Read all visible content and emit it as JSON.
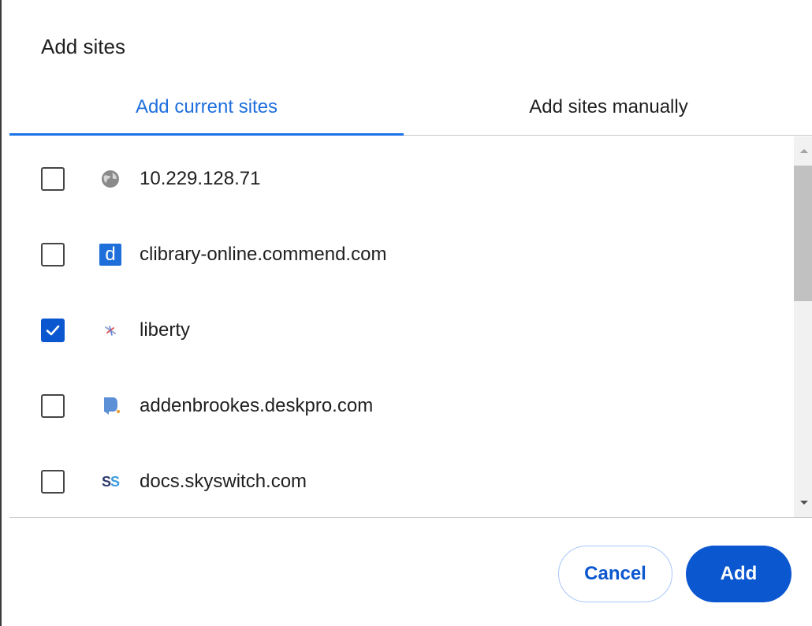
{
  "dialog": {
    "title": "Add sites"
  },
  "tabs": [
    {
      "label": "Add current sites",
      "active": true
    },
    {
      "label": "Add sites manually",
      "active": false
    }
  ],
  "sites": [
    {
      "label": "10.229.128.71",
      "checked": false,
      "icon": "globe-icon"
    },
    {
      "label": "clibrary-online.commend.com",
      "checked": false,
      "icon": "commend-d-icon"
    },
    {
      "label": "liberty",
      "checked": true,
      "icon": "liberty-icon"
    },
    {
      "label": "addenbrookes.deskpro.com",
      "checked": false,
      "icon": "deskpro-icon"
    },
    {
      "label": "docs.skyswitch.com",
      "checked": false,
      "icon": "skyswitch-icon"
    }
  ],
  "icons": {
    "skyswitch_text": "SS",
    "commend_text": "d"
  },
  "buttons": {
    "cancel": "Cancel",
    "add": "Add"
  },
  "colors": {
    "accent": "#0b57d0",
    "tab_active": "#1f6fde",
    "divider": "#c7c7c7"
  }
}
